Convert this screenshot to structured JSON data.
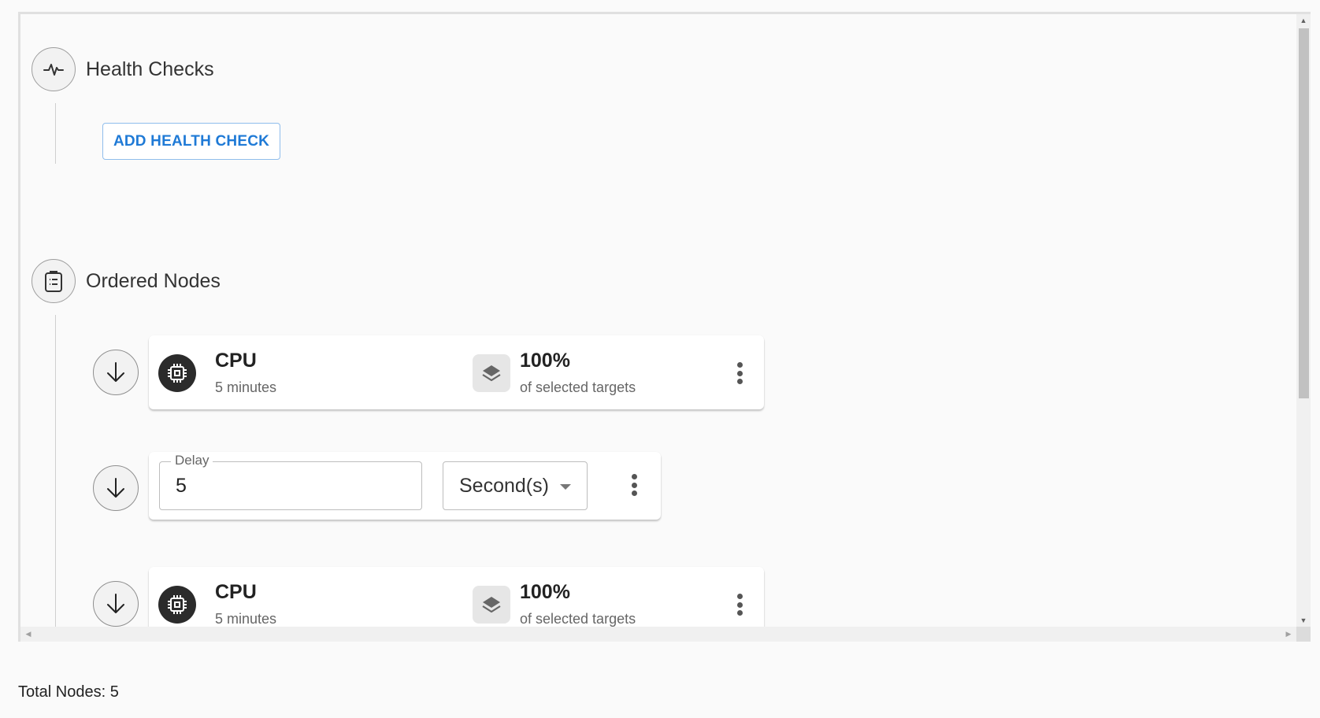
{
  "health_checks": {
    "title": "Health Checks",
    "icon": "pulse-icon",
    "add_button_label": "ADD HEALTH CHECK"
  },
  "ordered_nodes": {
    "title": "Ordered Nodes",
    "icon": "clipboard-list-icon",
    "items": [
      {
        "type": "fault",
        "icon": "cpu-chip-icon",
        "title": "CPU",
        "duration": "5 minutes",
        "target_icon": "layers-icon",
        "target_percent": "100%",
        "target_label": "of selected targets"
      },
      {
        "type": "delay",
        "label": "Delay",
        "value": "5",
        "unit": "Second(s)"
      },
      {
        "type": "fault",
        "icon": "cpu-chip-icon",
        "title": "CPU",
        "duration": "5 minutes",
        "target_icon": "layers-icon",
        "target_percent": "100%",
        "target_label": "of selected targets"
      }
    ]
  },
  "footer": {
    "total_nodes": "Total Nodes: 5"
  },
  "colors": {
    "accent": "#1f7ad6",
    "background": "#fafafa",
    "card": "#ffffff",
    "icon_dark": "#2b2b2b"
  }
}
